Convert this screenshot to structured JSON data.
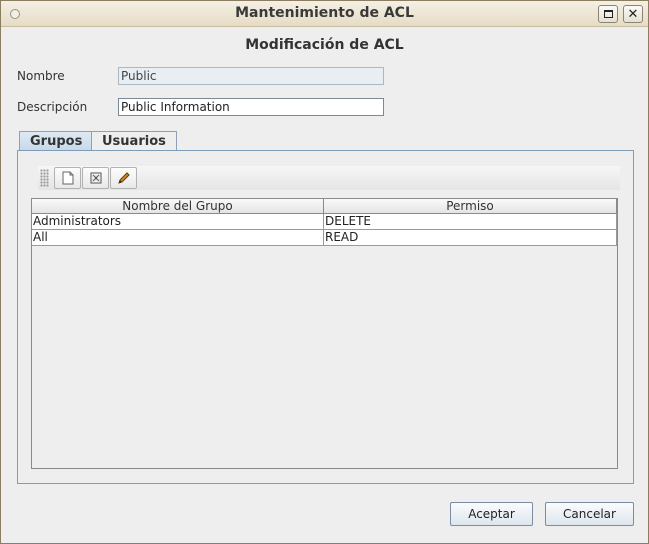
{
  "window": {
    "title": "Mantenimiento de ACL",
    "maximize_glyph": "maximize-icon",
    "close_glyph": "✕"
  },
  "form": {
    "heading": "Modificación de ACL",
    "name_label": "Nombre",
    "name_value": "Public",
    "description_label": "Descripción",
    "description_value": "Public Information"
  },
  "tabs": [
    {
      "label": "Grupos",
      "active": true
    },
    {
      "label": "Usuarios",
      "active": false
    }
  ],
  "toolbar": {
    "buttons": [
      {
        "icon": "new-document-icon"
      },
      {
        "icon": "delete-icon"
      },
      {
        "icon": "edit-pencil-icon"
      }
    ]
  },
  "table": {
    "columns": [
      "Nombre del Grupo",
      "Permiso"
    ],
    "rows": [
      [
        "Administrators",
        "DELETE"
      ],
      [
        "All",
        "READ"
      ]
    ]
  },
  "buttons": {
    "accept": "Aceptar",
    "cancel": "Cancelar"
  }
}
